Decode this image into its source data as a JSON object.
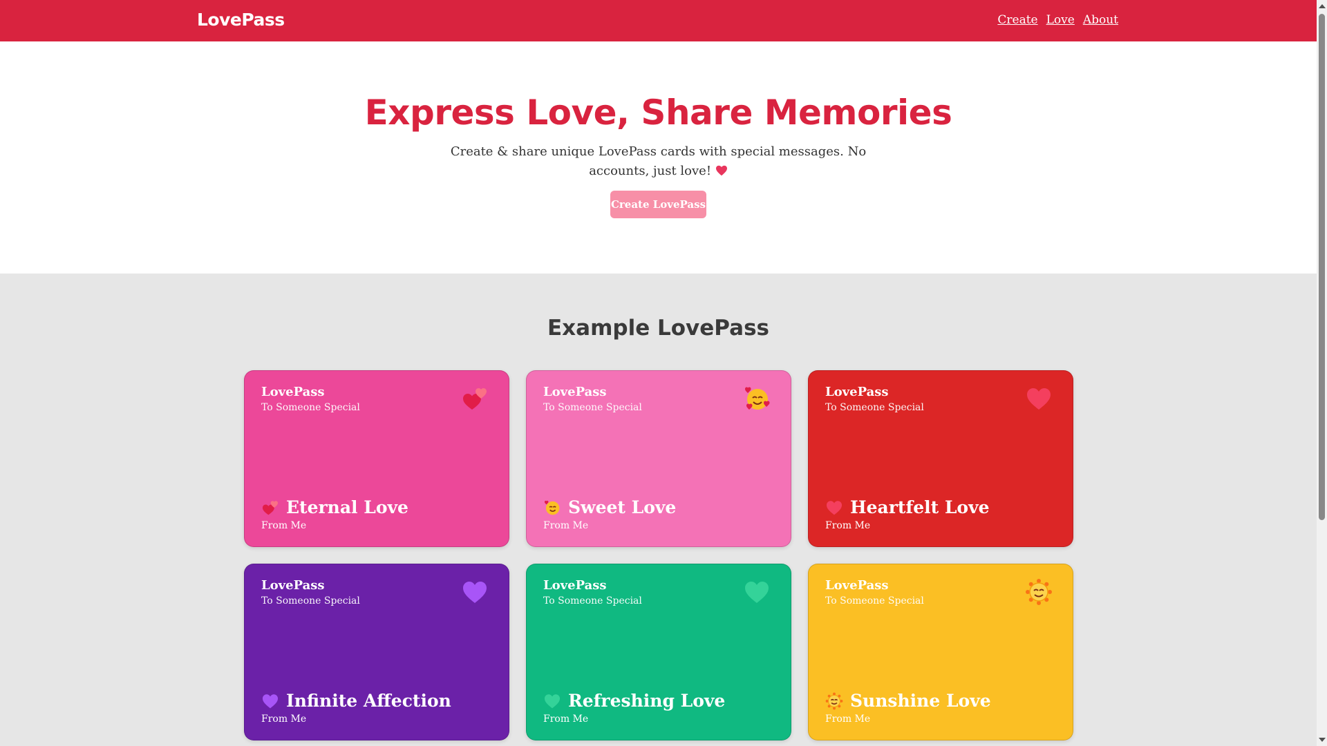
{
  "header": {
    "brand": "LovePass",
    "links": [
      "Create",
      "Love",
      "About"
    ],
    "color": "#d9233f"
  },
  "hero": {
    "title": "Express Love, Share Memories",
    "subtitle": "Create & share unique LovePass cards with special messages. No accounts, just love!",
    "button_label": "Create LovePass"
  },
  "examples": {
    "title": "Example LovePass",
    "cards": [
      {
        "brand": "LovePass",
        "to": "To Someone Special",
        "title": "Eternal Love",
        "from": "From Me",
        "color": "#ec4899",
        "icon": "two-hearts-icon"
      },
      {
        "brand": "LovePass",
        "to": "To Someone Special",
        "title": "Sweet Love",
        "from": "From Me",
        "color": "#f472b6",
        "icon": "smiling-face-with-hearts-icon"
      },
      {
        "brand": "LovePass",
        "to": "To Someone Special",
        "title": "Heartfelt Love",
        "from": "From Me",
        "color": "#dc2626",
        "icon": "red-heart-icon"
      },
      {
        "brand": "LovePass",
        "to": "To Someone Special",
        "title": "Infinite Affection",
        "from": "From Me",
        "color": "#6b21a8",
        "icon": "purple-heart-icon"
      },
      {
        "brand": "LovePass",
        "to": "To Someone Special",
        "title": "Refreshing Love",
        "from": "From Me",
        "color": "#10b981",
        "icon": "green-heart-icon"
      },
      {
        "brand": "LovePass",
        "to": "To Someone Special",
        "title": "Sunshine Love",
        "from": "From Me",
        "color": "#fbbf24",
        "icon": "sun-with-face-icon"
      }
    ]
  }
}
